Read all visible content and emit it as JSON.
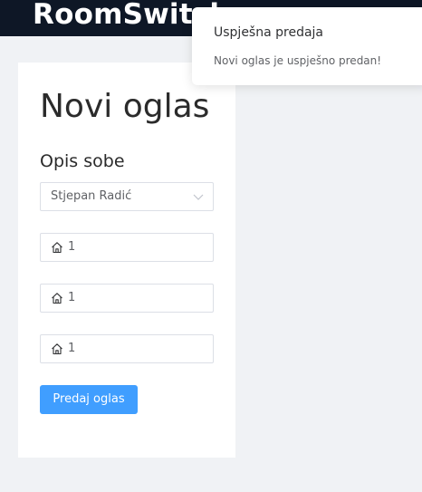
{
  "header": {
    "brand": "RoomSwitch"
  },
  "form": {
    "title": "Novi oglas",
    "section_title": "Opis sobe",
    "select": {
      "value": "Stjepan Radić",
      "icon": "chevron-down-icon"
    },
    "inputs": [
      {
        "icon": "home-icon",
        "value": "1"
      },
      {
        "icon": "home-icon",
        "value": "1"
      },
      {
        "icon": "home-icon",
        "value": "1"
      }
    ],
    "submit_label": "Predaj oglas"
  },
  "notification": {
    "title": "Uspješna predaja",
    "message": "Novi oglas je uspješno predan!"
  },
  "colors": {
    "header_bg": "#0e1726",
    "page_bg": "#f0f2f5",
    "primary": "#409eff"
  }
}
